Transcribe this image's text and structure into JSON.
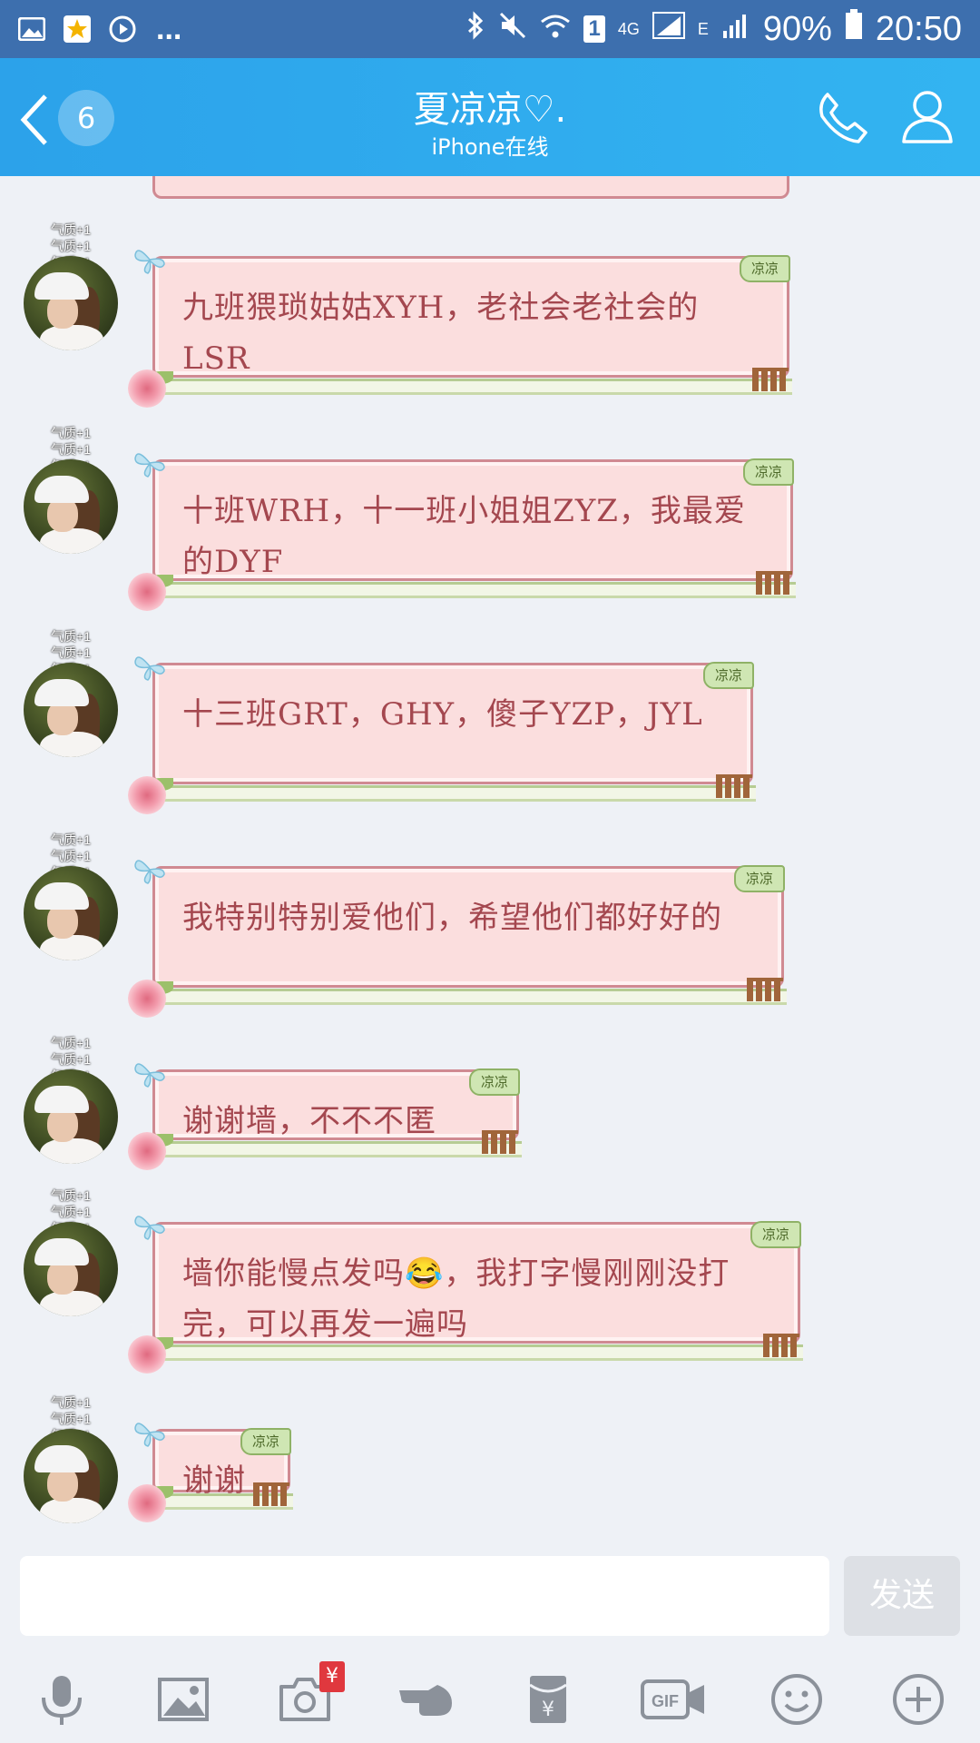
{
  "status_bar": {
    "signal_label": "4G",
    "sim_badge": "1",
    "network_e": "E",
    "battery": "90%",
    "time": "20:50",
    "overflow": "..."
  },
  "header": {
    "unread_count": "6",
    "title": "夏凉凉♡.",
    "subtitle": "iPhone在线"
  },
  "avatar_tags": [
    "气质+1",
    "气质+1",
    "气质+1"
  ],
  "bubble_tag": "凉凉",
  "messages": [
    {
      "text": "九班猥琐姑姑XYH，老社会老社会的LSR"
    },
    {
      "text": "十班WRH，十一班小姐姐ZYZ，我最爱的DYF"
    },
    {
      "text": "十三班GRT，GHY，傻子YZP，JYL"
    },
    {
      "text": "我特别特别爱他们，希望他们都好好的"
    },
    {
      "text": "谢谢墙，不不不匿"
    },
    {
      "text": "墙你能慢点发吗😂，我打字慢刚刚没打完，可以再发一遍吗"
    },
    {
      "text": "谢谢"
    }
  ],
  "composer": {
    "input_value": "",
    "send_label": "发送"
  },
  "toolbar": {
    "redpacket_badge": "¥",
    "gif_label": "GIF",
    "icons": [
      "microphone-icon",
      "image-icon",
      "camera-icon",
      "poke-icon",
      "red-packet-icon",
      "gif-icon",
      "emoji-icon",
      "plus-icon"
    ]
  },
  "colors": {
    "header": "#2ca2ea",
    "status_bar": "#3d6fae",
    "bubble_fill": "#fbdede",
    "bubble_text": "#a4474f"
  }
}
